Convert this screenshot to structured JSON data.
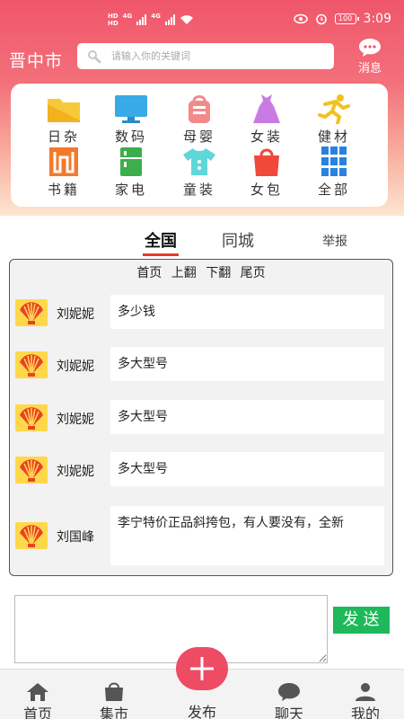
{
  "status_bar": {
    "time": "3:09",
    "battery": "100",
    "network_1": "4G",
    "network_2": "4G"
  },
  "header": {
    "city": "晋中市",
    "search_placeholder": "请输入你的关键词",
    "message_label": "消息"
  },
  "categories": [
    {
      "label": "日杂",
      "icon": "folder-icon",
      "color": "#f7c83a"
    },
    {
      "label": "数码",
      "icon": "monitor-icon",
      "color": "#3aa9e8"
    },
    {
      "label": "母婴",
      "icon": "baby-bag-icon",
      "color": "#f28a8a"
    },
    {
      "label": "女装",
      "icon": "dress-icon",
      "color": "#c97be4"
    },
    {
      "label": "健材",
      "icon": "running-icon",
      "color": "#f2c21c"
    },
    {
      "label": "书籍",
      "icon": "book-icon",
      "color": "#f27a2a"
    },
    {
      "label": "家电",
      "icon": "fridge-icon",
      "color": "#3cae4b"
    },
    {
      "label": "童装",
      "icon": "baby-clothes-icon",
      "color": "#5fd6d8"
    },
    {
      "label": "女包",
      "icon": "handbag-icon",
      "color": "#f0483b"
    },
    {
      "label": "全部",
      "icon": "grid-icon",
      "color": "#2a82e0"
    }
  ],
  "tabs": {
    "national": "全国",
    "local": "同城",
    "report": "举报"
  },
  "pager": {
    "first": "首页",
    "prev": "上翻",
    "next": "下翻",
    "last": "尾页"
  },
  "messages": [
    {
      "user": "刘妮妮",
      "text": "多少钱"
    },
    {
      "user": "刘妮妮",
      "text": "多大型号"
    },
    {
      "user": "刘妮妮",
      "text": "多大型号"
    },
    {
      "user": "刘妮妮",
      "text": "多大型号"
    },
    {
      "user": "刘国峰",
      "text": "李宁特价正品斜挎包，有人要没有，全新"
    }
  ],
  "compose": {
    "send_label": "发送"
  },
  "bottom_nav": {
    "home": "首页",
    "market": "集市",
    "publish": "发布",
    "chat": "聊天",
    "mine": "我的"
  },
  "colors": {
    "accent": "#f0566b",
    "send": "#1fb85a",
    "tab_underline": "#e63a2a"
  }
}
